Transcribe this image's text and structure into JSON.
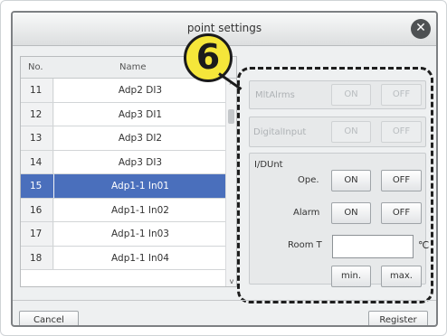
{
  "dialog": {
    "title": "point settings",
    "close_icon": "close-icon"
  },
  "badge": {
    "number": "6",
    "color": "#f5e63a"
  },
  "list": {
    "headers": {
      "no": "No.",
      "name": "Name"
    },
    "rows": [
      {
        "no": "11",
        "name": "Adp2 DI3"
      },
      {
        "no": "12",
        "name": "Adp3 DI1"
      },
      {
        "no": "13",
        "name": "Adp3 DI2"
      },
      {
        "no": "14",
        "name": "Adp3 DI3"
      },
      {
        "no": "15",
        "name": "Adp1-1 In01"
      },
      {
        "no": "16",
        "name": "Adp1-1 In02"
      },
      {
        "no": "17",
        "name": "Adp1-1 In03"
      },
      {
        "no": "18",
        "name": "Adp1-1 In04"
      }
    ],
    "selected_no": "15",
    "selection_color": "#4a6fbc"
  },
  "settings": {
    "mltalrms": {
      "label": "MltAlrms",
      "on": "ON",
      "off": "OFF"
    },
    "digitalinput": {
      "label": "DigitalInput",
      "on": "ON",
      "off": "OFF"
    },
    "idunt": {
      "label": "I/DUnt",
      "ope_label": "Ope.",
      "ope_on": "ON",
      "ope_off": "OFF",
      "alarm_label": "Alarm",
      "alarm_on": "ON",
      "alarm_off": "OFF",
      "room_label": "Room T",
      "room_value": "",
      "room_unit": "℃",
      "min": "min.",
      "max": "max."
    }
  },
  "footer": {
    "cancel": "Cancel",
    "register": "Register"
  }
}
